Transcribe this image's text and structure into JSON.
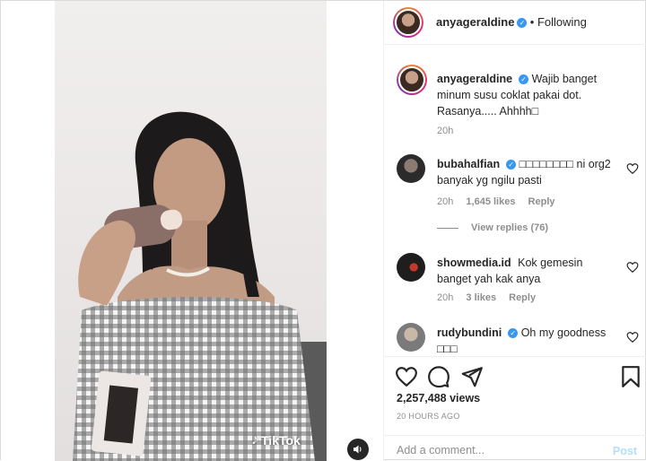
{
  "post": {
    "author": "anyageraldine",
    "follow_status": "Following",
    "caption_user": "anyageraldine",
    "caption_text": "Wajib banget minum susu coklat pakai dot. Rasanya..... Ahhhh□",
    "caption_time": "20h",
    "watermark": "TikTok"
  },
  "comments": [
    {
      "user": "bubahalfian",
      "verified": true,
      "text": "□□□□□□□□ ni org2 banyak yg ngilu pasti",
      "time": "20h",
      "likes": "1,645 likes",
      "reply": "Reply",
      "view_replies": "View replies (76)"
    },
    {
      "user": "showmedia.id",
      "verified": false,
      "text": "Kok gemesin banget yah kak anya",
      "time": "20h",
      "likes": "3 likes",
      "reply": "Reply"
    },
    {
      "user": "rudybundini",
      "verified": true,
      "text": "Oh my goodness □□□"
    }
  ],
  "stats": {
    "views": "2,257,488 views",
    "posted": "20 HOURS AGO"
  },
  "add_comment": {
    "placeholder": "Add a comment...",
    "post_label": "Post"
  },
  "icons": {
    "like": "heart-icon",
    "comment": "comment-bubble-icon",
    "share": "paper-plane-icon",
    "save": "bookmark-icon",
    "audio": "speaker-icon",
    "verified": "verified-badge-icon"
  },
  "colors": {
    "verified": "#3897f0",
    "post_button": "#b2dffc",
    "muted_text": "#8e8e8e"
  }
}
